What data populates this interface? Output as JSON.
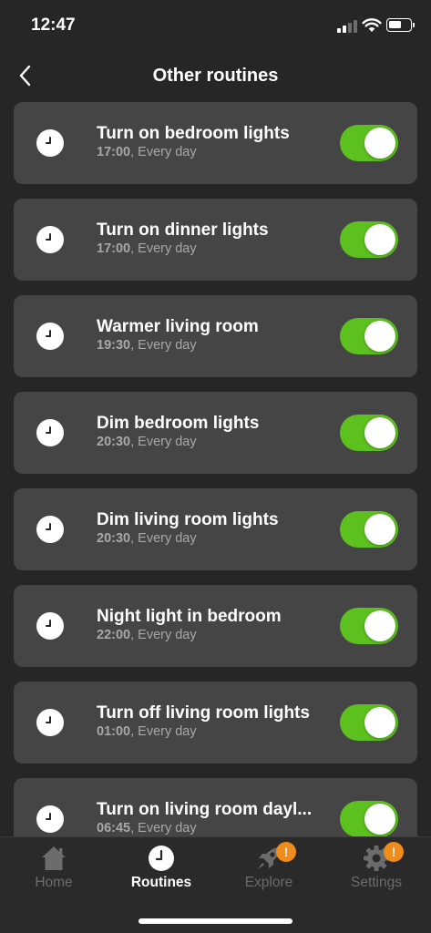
{
  "status_bar": {
    "time": "12:47",
    "battery_level": 0.6
  },
  "header": {
    "title": "Other routines",
    "back_icon": "chevron-left-icon"
  },
  "routines": [
    {
      "name": "Turn on bedroom lights",
      "time": "17:00",
      "repeat": ", Every day",
      "enabled": true
    },
    {
      "name": "Turn on dinner lights",
      "time": "17:00",
      "repeat": ", Every day",
      "enabled": true
    },
    {
      "name": "Warmer living room",
      "time": "19:30",
      "repeat": ", Every day",
      "enabled": true
    },
    {
      "name": "Dim bedroom lights",
      "time": "20:30",
      "repeat": ", Every day",
      "enabled": true
    },
    {
      "name": "Dim living room lights",
      "time": "20:30",
      "repeat": ", Every day",
      "enabled": true
    },
    {
      "name": "Night light in bedroom",
      "time": "22:00",
      "repeat": ", Every day",
      "enabled": true
    },
    {
      "name": "Turn off living room lights",
      "time": "01:00",
      "repeat": ", Every day",
      "enabled": true
    },
    {
      "name": "Turn on living room dayl...",
      "time": "06:45",
      "repeat": ", Every day",
      "enabled": true
    }
  ],
  "tabs": [
    {
      "label": "Home",
      "icon": "home-icon",
      "active": false,
      "badge": ""
    },
    {
      "label": "Routines",
      "icon": "clock-icon",
      "active": true,
      "badge": ""
    },
    {
      "label": "Explore",
      "icon": "rocket-icon",
      "active": false,
      "badge": "!"
    },
    {
      "label": "Settings",
      "icon": "gear-icon",
      "active": false,
      "badge": "!"
    }
  ],
  "colors": {
    "background": "#262626",
    "card": "#454545",
    "toggle_on": "#5cc11f",
    "badge": "#f08c1c",
    "inactive_tab": "#6c6c6c"
  }
}
